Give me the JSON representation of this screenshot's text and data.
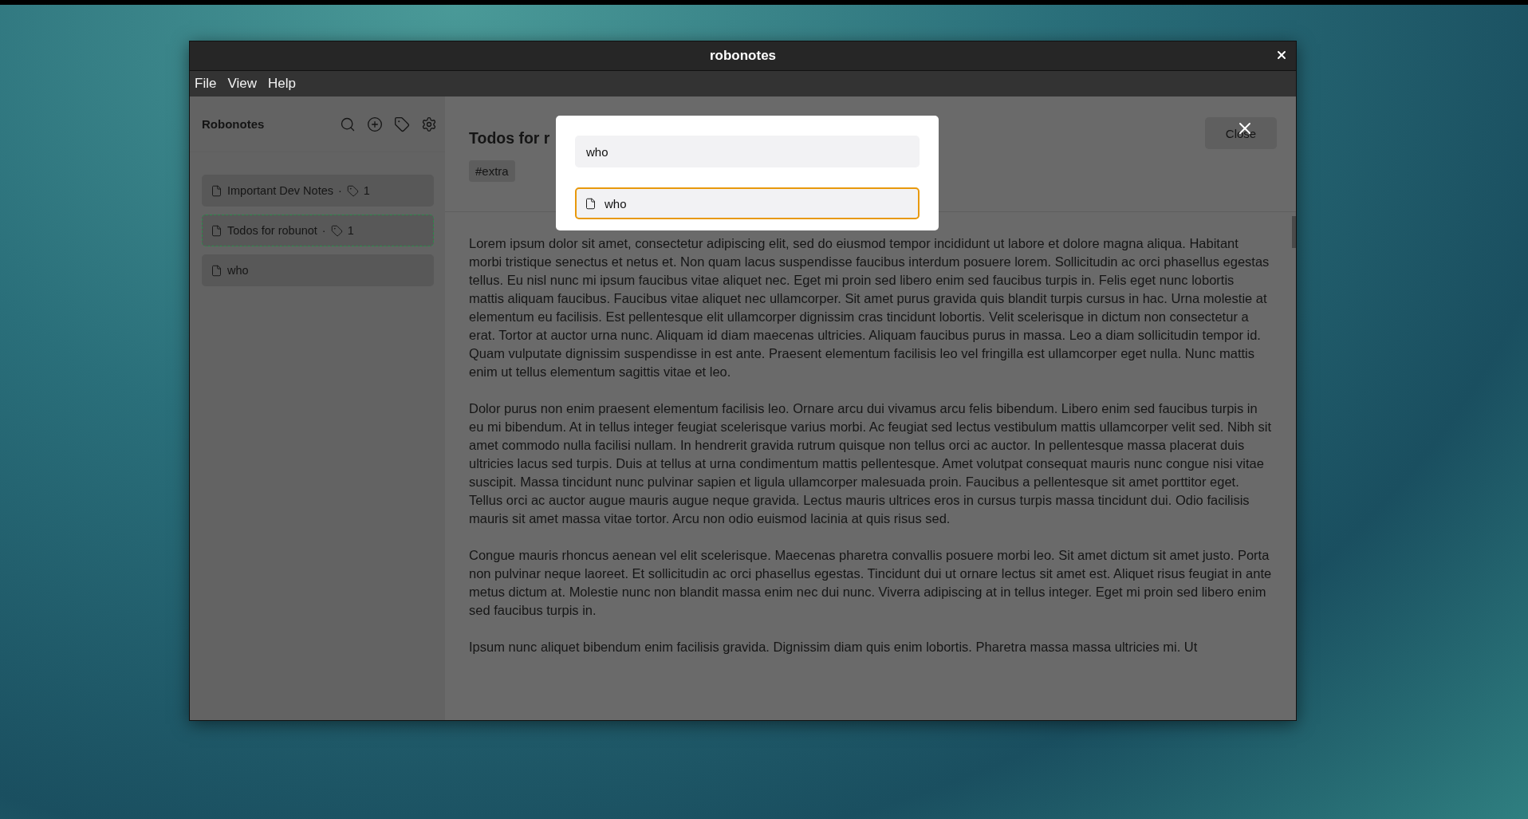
{
  "window": {
    "title": "robonotes"
  },
  "menu": [
    "File",
    "View",
    "Help"
  ],
  "sidebar": {
    "title": "Robonotes",
    "notes": [
      {
        "title": "Important Dev Notes",
        "separator": "·",
        "tag_count": "1",
        "selected": false
      },
      {
        "title": "Todos for robunot",
        "separator": "·",
        "tag_count": "1",
        "selected": true
      },
      {
        "title": "who",
        "selected": false
      }
    ]
  },
  "note": {
    "title": "Todos for r",
    "tags": [
      "#extra"
    ],
    "close_button": "Close",
    "paragraphs": [
      "Lorem ipsum dolor sit amet, consectetur adipiscing elit, sed do eiusmod tempor incididunt ut labore et dolore magna aliqua. Habitant morbi tristique senectus et netus et. Non quam lacus suspendisse faucibus interdum posuere lorem. Sollicitudin ac orci phasellus egestas tellus. Eu nisl nunc mi ipsum faucibus vitae aliquet nec. Eget mi proin sed libero enim sed faucibus turpis in. Felis eget nunc lobortis mattis aliquam faucibus. Faucibus vitae aliquet nec ullamcorper. Sit amet purus gravida quis blandit turpis cursus in hac. Urna molestie at elementum eu facilisis. Est pellentesque elit ullamcorper dignissim cras tincidunt lobortis. Velit scelerisque in dictum non consectetur a erat. Tortor at auctor urna nunc. Aliquam id diam maecenas ultricies. Aliquam faucibus purus in massa. Leo a diam sollicitudin tempor id. Quam vulputate dignissim suspendisse in est ante. Praesent elementum facilisis leo vel fringilla est ullamcorper eget nulla. Nunc mattis enim ut tellus elementum sagittis vitae et leo.",
      "Dolor purus non enim praesent elementum facilisis leo. Ornare arcu dui vivamus arcu felis bibendum. Libero enim sed faucibus turpis in eu mi bibendum. At in tellus integer feugiat scelerisque varius morbi. Ac feugiat sed lectus vestibulum mattis ullamcorper velit sed. Nibh sit amet commodo nulla facilisi nullam. In hendrerit gravida rutrum quisque non tellus orci ac auctor. In pellentesque massa placerat duis ultricies lacus sed turpis. Duis at tellus at urna condimentum mattis pellentesque. Amet volutpat consequat mauris nunc congue nisi vitae suscipit. Massa tincidunt nunc pulvinar sapien et ligula ullamcorper malesuada proin. Faucibus a pellentesque sit amet porttitor eget. Tellus orci ac auctor augue mauris augue neque gravida. Lectus mauris ultrices eros in cursus turpis massa tincidunt dui. Odio facilisis mauris sit amet massa vitae tortor. Arcu non odio euismod lacinia at quis risus sed.",
      "Congue mauris rhoncus aenean vel elit scelerisque. Maecenas pharetra convallis posuere morbi leo. Sit amet dictum sit amet justo. Porta non pulvinar neque laoreet. Et sollicitudin ac orci phasellus egestas. Tincidunt dui ut ornare lectus sit amet est. Aliquet risus feugiat in ante metus dictum at. Molestie nunc non blandit massa enim nec dui nunc. Viverra adipiscing at in tellus integer. Eget mi proin sed libero enim sed faucibus turpis in.",
      "Ipsum nunc aliquet bibendum enim facilisis gravida. Dignissim diam quis enim lobortis. Pharetra massa massa ultricies mi. Ut"
    ]
  },
  "search_dialog": {
    "query": "who",
    "results": [
      {
        "title": "who",
        "selected": true
      }
    ]
  }
}
